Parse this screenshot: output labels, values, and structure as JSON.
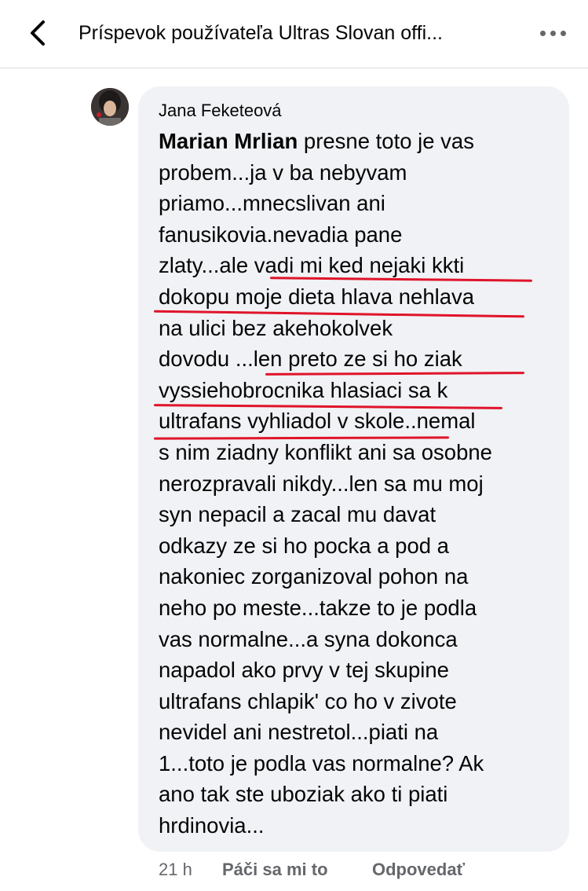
{
  "header": {
    "title": "Príspevok používateľa Ultras Slovan offi...",
    "back_icon": "chevron-left-icon",
    "more_icon": "more-horizontal-icon"
  },
  "comment": {
    "author": "Jana Feketeová",
    "mention": "Marian Mrlian",
    "lines": [
      " presne toto je vas",
      "probem...ja v ba nebyvam",
      "priamo...mnecslivan ani",
      "fanusikovia.nevadia pane",
      "zlaty...ale vadi mi ked nejaki kkti",
      "dokopu moje dieta hlava nehlava",
      "na ulici bez akehokolvek",
      "dovodu ...len preto ze si ho ziak",
      "vyssiehobrocnika hlasiaci sa k",
      "ultrafans vyhliadol v skole..nemal",
      "s nim ziadny konflikt ani sa osobne",
      "nerozpravali nikdy...len sa mu moj",
      "syn nepacil a zacal mu davat",
      "odkazy ze si ho pocka a pod a",
      "nakoniec zorganizoval pohon na",
      "neho po meste...takze to je podla",
      "vas normalne...a syna dokonca",
      "napadol ako prvy v tej skupine",
      "ultrafans chlapik' co ho v zivote",
      "nevidel ani nestretol...piati na",
      "1...toto je podla vas normalne? Ak",
      "ano tak ste uboziak ako ti piati",
      "hrdinovia..."
    ],
    "time": "21 h",
    "like_label": "Páči sa mi to",
    "reply_label": "Odpovedať"
  },
  "colors": {
    "bubble": "#f0f2f5",
    "underline": "#e0142a",
    "meta_text": "#65676b"
  }
}
